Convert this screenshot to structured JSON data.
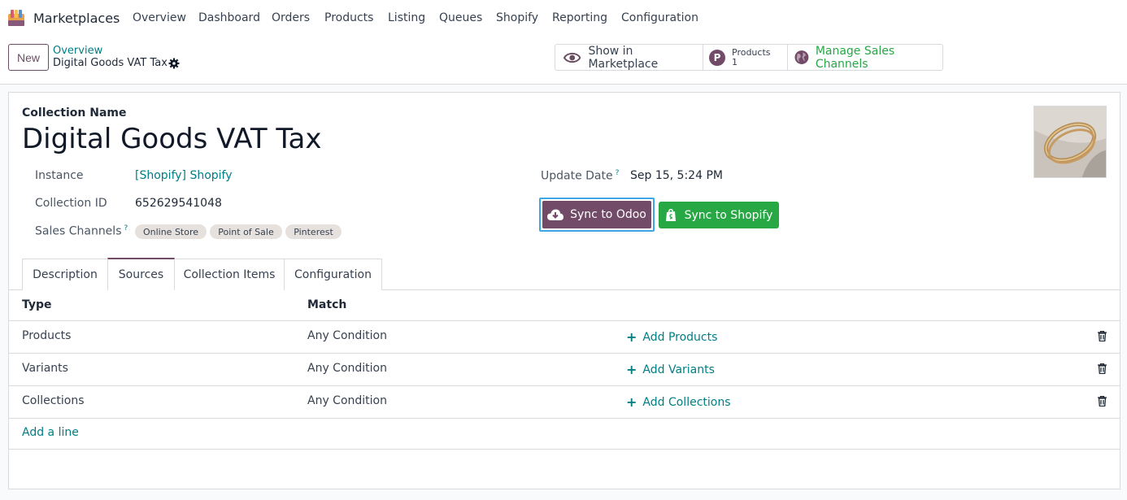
{
  "nav": {
    "app_name": "Marketplaces",
    "menu": [
      "Overview",
      "Dashboard",
      "Orders",
      "Products",
      "Listing",
      "Queues",
      "Shopify",
      "Reporting",
      "Configuration"
    ]
  },
  "control": {
    "new_label": "New",
    "breadcrumb_parent": "Overview",
    "breadcrumb_current": "Digital Goods VAT Tax"
  },
  "smart_buttons": {
    "show_label": "Show in Marketplace",
    "products_label": "Products",
    "products_count": "1",
    "products_avatar": "P",
    "sales_channels_label": "Manage Sales Channels"
  },
  "form": {
    "collection_name_label": "Collection Name",
    "title": "Digital Goods VAT Tax",
    "instance_label": "Instance",
    "instance_value": "[Shopify] Shopify",
    "collection_id_label": "Collection ID",
    "collection_id_value": "652629541048",
    "sales_channels_label": "Sales Channels",
    "help_mark": "?",
    "tags": [
      "Online Store",
      "Point of Sale",
      "Pinterest"
    ],
    "update_date_label": "Update Date",
    "update_date_value": "Sep 15, 5:24 PM",
    "sync_odoo_label": "Sync to Odoo",
    "sync_shopify_label": "Sync to Shopify"
  },
  "tabs": [
    "Description",
    "Sources",
    "Collection Items",
    "Configuration"
  ],
  "active_tab": "Sources",
  "table": {
    "headers": [
      "Type",
      "Match"
    ],
    "rows": [
      {
        "type": "Products",
        "match": "Any Condition",
        "action": "Add Products"
      },
      {
        "type": "Variants",
        "match": "Any Condition",
        "action": "Add Variants"
      },
      {
        "type": "Collections",
        "match": "Any Condition",
        "action": "Add Collections"
      }
    ],
    "add_line": "Add a line"
  },
  "colors": {
    "primary": "#714b67",
    "link": "#017e84",
    "success": "#28a745",
    "focus": "#3ea7e5"
  }
}
